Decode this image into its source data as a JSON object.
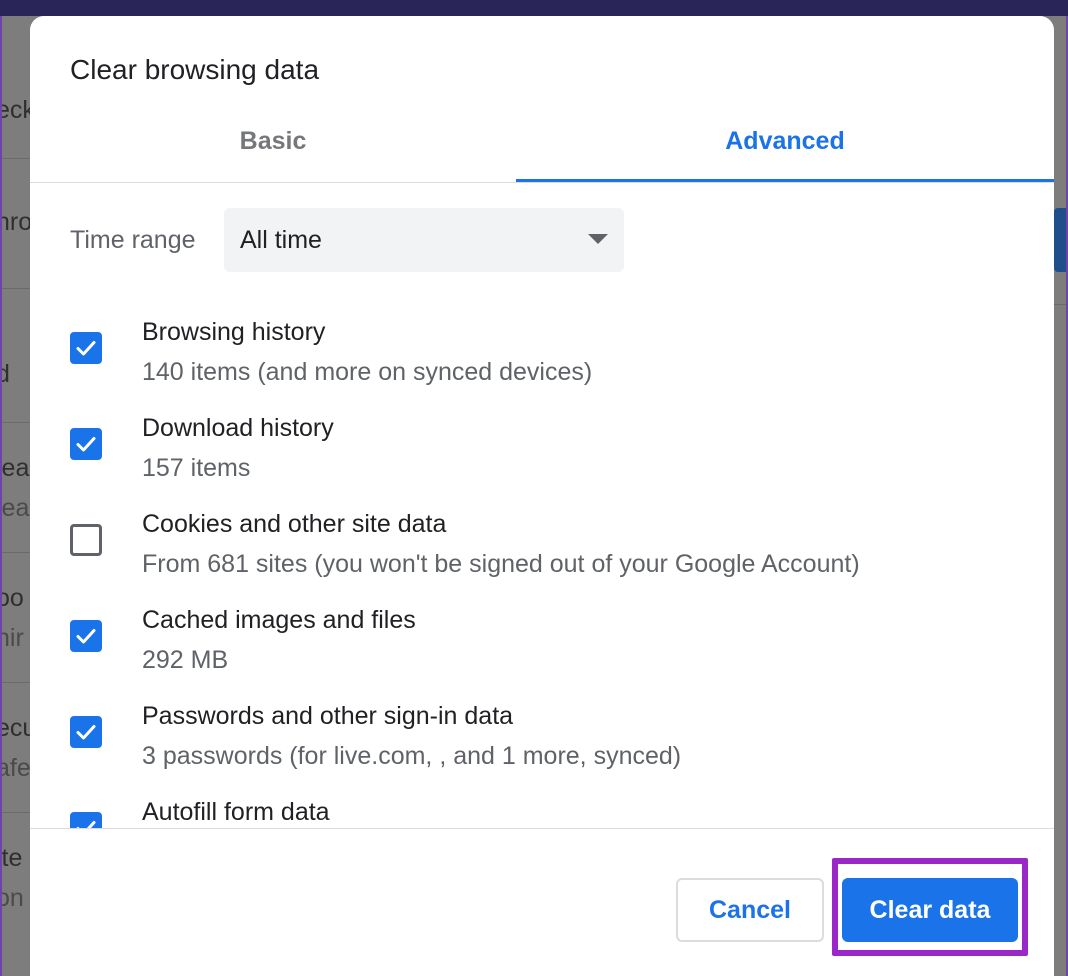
{
  "dialog": {
    "title": "Clear browsing data",
    "tabs": [
      {
        "label": "Basic",
        "active": false
      },
      {
        "label": "Advanced",
        "active": true
      }
    ],
    "time_range": {
      "label": "Time range",
      "value": "All time"
    },
    "items": [
      {
        "title": "Browsing history",
        "subtitle": "140 items (and more on synced devices)",
        "checked": true
      },
      {
        "title": "Download history",
        "subtitle": "157 items",
        "checked": true
      },
      {
        "title": "Cookies and other site data",
        "subtitle": "From 681 sites (you won't be signed out of your Google Account)",
        "checked": false
      },
      {
        "title": "Cached images and files",
        "subtitle": "292 MB",
        "checked": true
      },
      {
        "title": "Passwords and other sign-in data",
        "subtitle": "3 passwords (for live.com, , and 1 more, synced)",
        "checked": true
      },
      {
        "title": "Autofill form data",
        "subtitle": "",
        "checked": true
      }
    ],
    "buttons": {
      "cancel": "Cancel",
      "clear": "Clear data"
    }
  },
  "background": {
    "fragments": [
      "eck",
      "hro",
      "d",
      "lea",
      "lea",
      "oo",
      "hir",
      "ecu",
      "afe",
      "ite",
      "on"
    ]
  },
  "colors": {
    "accent": "#1a73e8",
    "highlight": "#9b27c8"
  }
}
